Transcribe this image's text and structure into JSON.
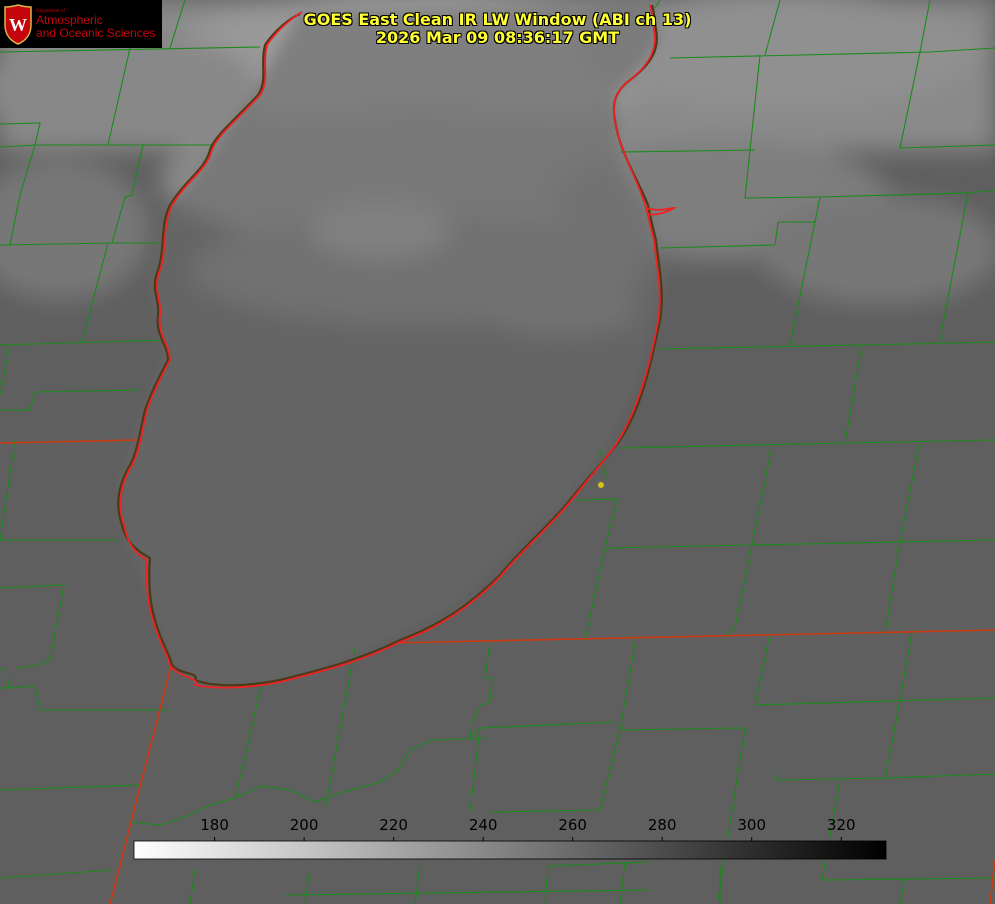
{
  "logo": {
    "dept": "Department of",
    "line1": "Atmospheric",
    "line2": "and Oceanic Sciences",
    "shield_letter": "W",
    "icon": "uw-crest-icon"
  },
  "title": {
    "line1": "GOES East Clean IR LW Window (ABI ch 13)",
    "line2": "2026 Mar 09 08:36:17 GMT"
  },
  "colorbar": {
    "min": 162,
    "max": 330,
    "ticks": [
      "180",
      "200",
      "220",
      "240",
      "260",
      "280",
      "300",
      "320"
    ],
    "tick_values": [
      180,
      200,
      220,
      240,
      260,
      280,
      300,
      320
    ],
    "colors": {
      "cold": "#ffffff",
      "warm": "#000000"
    }
  },
  "map": {
    "colors": {
      "county": "#1a8a1a",
      "state": "#cc3a10",
      "lake_shore": "#ee2222",
      "marker": "#d6c21a",
      "land": "#5f5f5f",
      "lake": "#6b6b6b"
    },
    "marker_icon": "location-dot-icon"
  }
}
